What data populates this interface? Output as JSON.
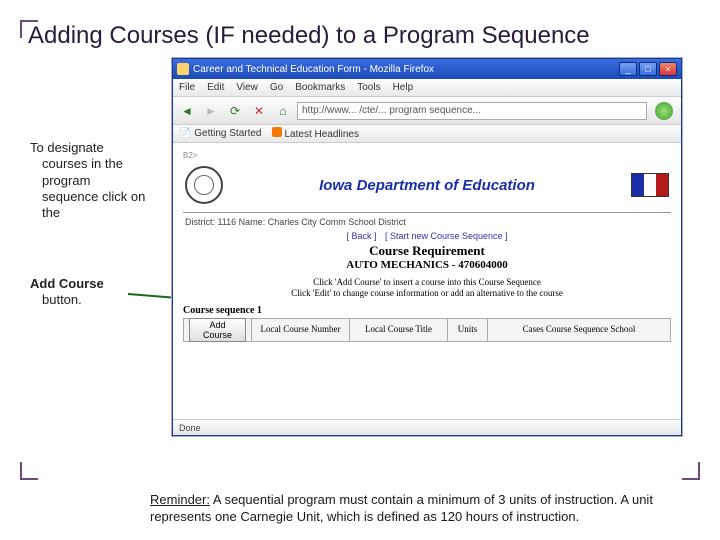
{
  "title": "Adding Courses (IF needed) to a Program Sequence",
  "side": {
    "note1_a": "To designate",
    "note1_b": "courses in the program sequence click on the",
    "note2_a": "Add Course",
    "note2_b": "button."
  },
  "footnote": {
    "lead": "Reminder:",
    "text": "A sequential program must contain a minimum of 3 units of instruction. A unit represents one Carnegie Unit, which is defined as 120 hours of instruction."
  },
  "browser": {
    "title": "Career and Technical Education Form - Mozilla Firefox",
    "menus": [
      "File",
      "Edit",
      "View",
      "Go",
      "Bookmarks",
      "Tools",
      "Help"
    ],
    "url": "http://www... /cte/... program sequence...",
    "bookmarks": [
      "Getting Started",
      "Latest Headlines"
    ],
    "status": "Done"
  },
  "page": {
    "dept": "Iowa Department of Education",
    "district": "District: 1116   Name: Charles City Comm School District",
    "link_back": "[ Back ]",
    "link_seq": "[ Start new Course Sequence ]",
    "heading": "Course Requirement",
    "subheading": "AUTO MECHANICS - 470604000",
    "hint1": "Click 'Add Course' to insert a course into this Course Sequence",
    "hint2": "Click 'Edit' to change course information or add an alternative to the course",
    "seq_label": "Course sequence 1",
    "btn_add": "Add Course",
    "cols": [
      "Local Course Number",
      "Local Course Title",
      "Units",
      "Cases Course Sequence School"
    ]
  }
}
